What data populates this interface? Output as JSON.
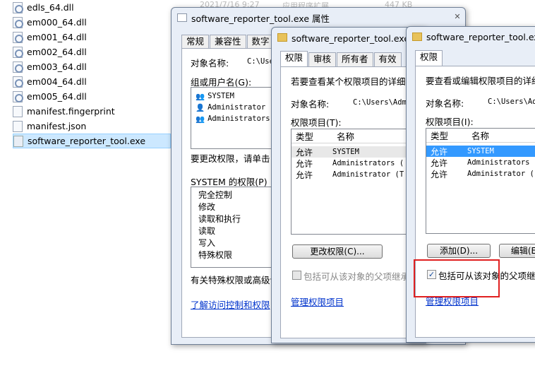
{
  "explorer": {
    "files": [
      {
        "name": "edls_64.dll",
        "icon": "dll-file-icon"
      },
      {
        "name": "em000_64.dll",
        "icon": "dll-file-icon"
      },
      {
        "name": "em001_64.dll",
        "icon": "dll-file-icon"
      },
      {
        "name": "em002_64.dll",
        "icon": "dll-file-icon"
      },
      {
        "name": "em003_64.dll",
        "icon": "dll-file-icon"
      },
      {
        "name": "em004_64.dll",
        "icon": "dll-file-icon"
      },
      {
        "name": "em005_64.dll",
        "icon": "dll-file-icon"
      },
      {
        "name": "manifest.fingerprint",
        "icon": "file-icon"
      },
      {
        "name": "manifest.json",
        "icon": "file-icon"
      },
      {
        "name": "software_reporter_tool.exe",
        "icon": "exe-file-icon"
      }
    ],
    "selected_index": 9,
    "ghost_date": "2021/7/16 9:27",
    "ghost_type": "应用程序扩展",
    "ghost_size": "447 KB"
  },
  "win1": {
    "title": "software_reporter_tool.exe 属性",
    "tabs": [
      "常规",
      "兼容性",
      "数字"
    ],
    "object_label": "对象名称:",
    "object_value": "C:\\Users",
    "group_label": "组或用户名(G):",
    "users": [
      "SYSTEM",
      "Administrator (",
      "Administrators"
    ],
    "change_hint": "要更改权限，请单击 '",
    "perm_label": "SYSTEM 的权限(P)",
    "perms": [
      "完全控制",
      "修改",
      "读取和执行",
      "读取",
      "写入",
      "特殊权限"
    ],
    "special_hint": "有关特殊权限或高级设",
    "link": "了解访问控制和权限"
  },
  "win2": {
    "title": "software_reporter_tool.exe 的",
    "tabs": [
      "权限",
      "审核",
      "所有者",
      "有效"
    ],
    "intro": "若要查看某个权限项目的详细信",
    "object_label": "对象名称:",
    "object_value": "C:\\Users\\Admi",
    "entries_label": "权限项目(T):",
    "col_type": "类型",
    "col_name": "名称",
    "rows": [
      {
        "type": "允许",
        "name": "SYSTEM"
      },
      {
        "type": "允许",
        "name": "Administrators ("
      },
      {
        "type": "允许",
        "name": "Administrator (T"
      }
    ],
    "change_btn": "更改权限(C)...",
    "inherit_label": "包括可从该对象的父项继承",
    "link": "管理权限项目"
  },
  "win3": {
    "title": "software_reporter_tool.exe",
    "tabs": [
      "权限"
    ],
    "intro": "要查看或编辑权限项目的详细",
    "object_label": "对象名称:",
    "object_value": "C:\\Users\\Ad",
    "entries_label": "权限项目(I):",
    "col_type": "类型",
    "col_name": "名称",
    "rows": [
      {
        "type": "允许",
        "name": "SYSTEM"
      },
      {
        "type": "允许",
        "name": "Administrators"
      },
      {
        "type": "允许",
        "name": "Administrator ("
      }
    ],
    "add_btn": "添加(D)...",
    "edit_btn": "编辑(E",
    "inherit_label": "包括可从该对象的父项继承",
    "inherit_checked": "✓",
    "link": "管理权限项目"
  }
}
